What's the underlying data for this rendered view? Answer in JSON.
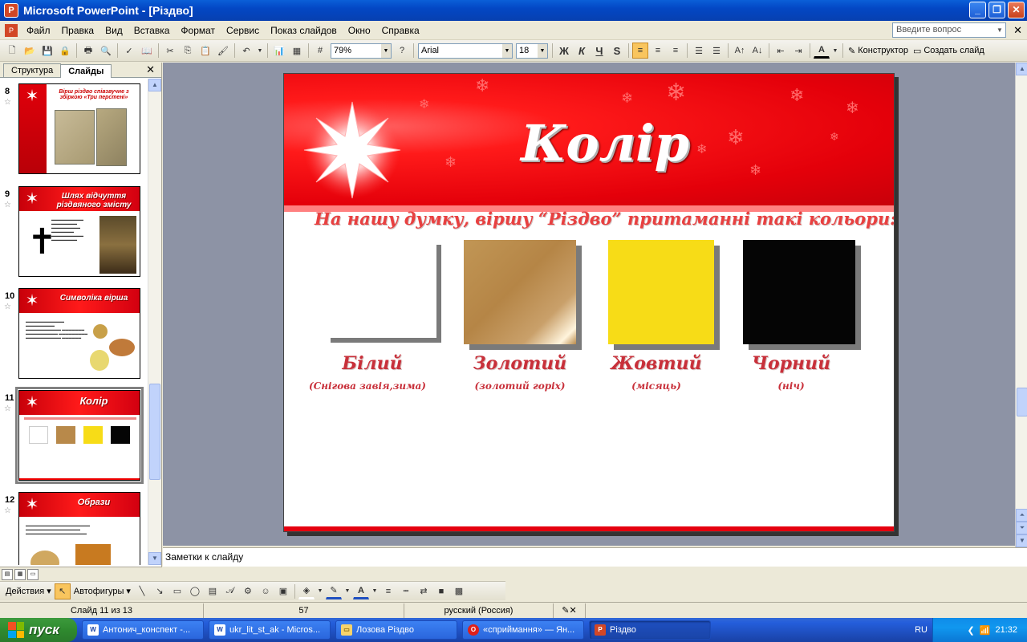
{
  "window": {
    "title": "Microsoft PowerPoint - [Різдво]"
  },
  "menu": {
    "items": [
      "Файл",
      "Правка",
      "Вид",
      "Вставка",
      "Формат",
      "Сервис",
      "Показ слайдов",
      "Окно",
      "Справка"
    ],
    "ask_placeholder": "Введите вопрос"
  },
  "toolbar": {
    "zoom": "79%",
    "font": "Arial",
    "size": "18",
    "bold": "Ж",
    "italic": "К",
    "underline": "Ч",
    "shadow": "S",
    "designer": "Конструктор",
    "new_slide": "Создать слайд"
  },
  "pane": {
    "tabs": [
      "Структура",
      "Слайды"
    ]
  },
  "thumbs": [
    {
      "num": "8",
      "title": "Вірш різдво співзвучне з збіркою «Три перстені»"
    },
    {
      "num": "9",
      "title": "Шлях відчуття різдвяного змісту"
    },
    {
      "num": "10",
      "title": "Символіка вірша"
    },
    {
      "num": "11",
      "title": "Колір"
    },
    {
      "num": "12",
      "title": "Образи"
    }
  ],
  "slide": {
    "title": "Колір",
    "subtitle": "На нашу думку, вiршу “Різдво” притаманні такі кольори:",
    "colors": [
      {
        "name": "Білий",
        "note": "(Снігова завія,зима)",
        "hex": "#ffffff"
      },
      {
        "name": "Золотий",
        "note": "(золотий горіх)",
        "hex": "#b8894a"
      },
      {
        "name": "Жовтий",
        "note": "(місяць)",
        "hex": "#f7dc17"
      },
      {
        "name": "Чорний",
        "note": "(ніч)",
        "hex": "#050505"
      }
    ]
  },
  "notes": {
    "placeholder": "Заметки к слайду"
  },
  "drawing": {
    "actions": "Действия",
    "autoshapes": "Автофигуры"
  },
  "status": {
    "slide": "Слайд 11 из 13",
    "design": "57",
    "language": "русский (Россия)"
  },
  "taskbar": {
    "start": "пуск",
    "tasks": [
      "Антонич_конспект -...",
      "ukr_lit_st_ak - Micros...",
      "Лозова Різдво",
      "«сприймання» — Ян...",
      "Різдво"
    ],
    "lang": "RU",
    "clock": "21:32"
  }
}
